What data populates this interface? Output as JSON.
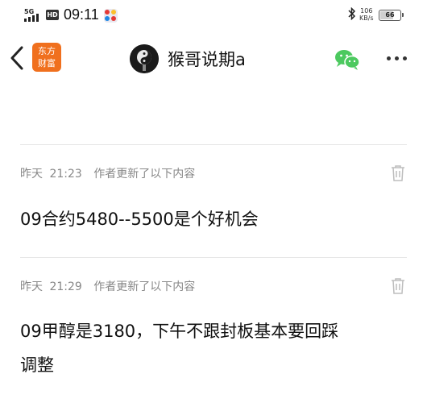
{
  "status_bar": {
    "network": "5G",
    "hd_badge": "HD",
    "time": "09:11",
    "net_speed_value": "106",
    "net_speed_unit": "KB/s",
    "battery_text": "66",
    "battery_level": 0.66
  },
  "nav": {
    "brand_line1": "东方",
    "brand_line2": "财富",
    "title": "猴哥说期a"
  },
  "messages": [
    {
      "date": "昨天",
      "time": "21:23",
      "note": "作者更新了以下内容",
      "text": "09合约5480--5500是个好机会"
    },
    {
      "date": "昨天",
      "time": "21:29",
      "note": "作者更新了以下内容",
      "text_line1": "09甲醇是3180，下午不跟封板基本要回踩",
      "text_line2": "调整"
    }
  ],
  "colors": {
    "brand": "#f0701e",
    "wechat": "#4cc95f",
    "meta_text": "#888888"
  },
  "icons": [
    "back-arrow-icon",
    "wechat-icon",
    "more-dots-icon",
    "trash-icon",
    "bluetooth-icon"
  ]
}
